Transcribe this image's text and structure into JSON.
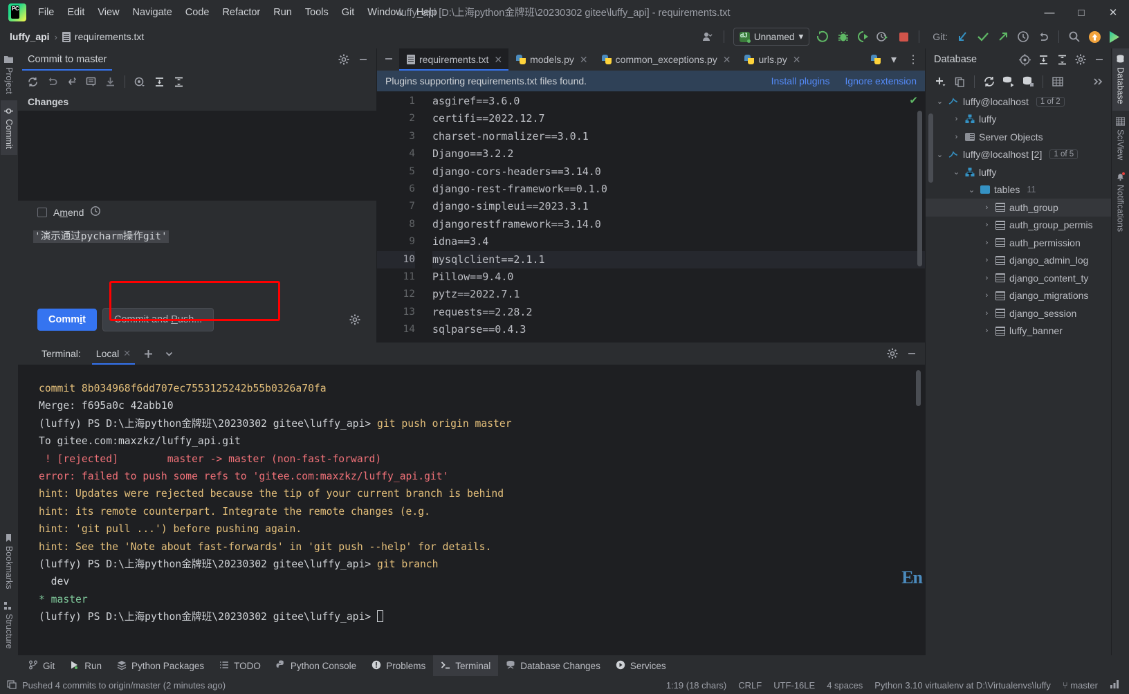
{
  "window": {
    "title": "luffy_api [D:\\上海python金牌班\\20230302 gitee\\luffy_api] - requirements.txt",
    "minimize": "—",
    "maximize": "□",
    "close": "✕"
  },
  "menu": {
    "items": [
      "File",
      "Edit",
      "View",
      "Navigate",
      "Code",
      "Refactor",
      "Run",
      "Tools",
      "Git",
      "Window",
      "Help"
    ]
  },
  "navbar": {
    "project": "luffy_api",
    "separator": "›",
    "file": "requirements.txt",
    "run_config": "Unnamed",
    "git_label": "Git:"
  },
  "left_stripe": {
    "items": [
      {
        "label": "Project",
        "icon": "folder-icon",
        "active": false
      },
      {
        "label": "Commit",
        "icon": "commit-icon",
        "active": true
      },
      {
        "label": "Bookmarks",
        "icon": "bookmark-icon",
        "active": false
      },
      {
        "label": "Structure",
        "icon": "structure-icon",
        "active": false
      }
    ]
  },
  "right_stripe": {
    "items": [
      {
        "label": "Database",
        "icon": "database-icon",
        "active": true
      },
      {
        "label": "SciView",
        "icon": "sciview-icon",
        "active": false
      },
      {
        "label": "Notifications",
        "icon": "bell-icon",
        "active": false
      }
    ]
  },
  "commit_panel": {
    "tab_label": "Commit to master",
    "changes_header": "Changes",
    "amend_label_pre": "A",
    "amend_label_underline": "m",
    "amend_label_post": "end",
    "message": "'演示通过pycharm操作git'",
    "commit_button": "Commit",
    "commit_button_underline": "i",
    "commit_push_button": "Commit and Push...",
    "toolbar_icons": [
      "refresh-icon",
      "rollback-icon",
      "revert-icon",
      "message-history-icon",
      "update-icon",
      "preview-diff-icon",
      "expand-all-icon",
      "collapse-all-icon"
    ],
    "header_icons": [
      "gear-icon",
      "minimize-icon"
    ]
  },
  "editor": {
    "tabs": [
      {
        "label": "requirements.txt",
        "icon": "text-file-icon",
        "active": true
      },
      {
        "label": "models.py",
        "icon": "python-file-icon",
        "active": false
      },
      {
        "label": "common_exceptions.py",
        "icon": "python-file-icon",
        "active": false
      },
      {
        "label": "urls.py",
        "icon": "python-file-icon",
        "active": false
      }
    ],
    "notification": {
      "text": "Plugins supporting requirements.txt files found.",
      "install_link": "Install plugins",
      "ignore_link": "Ignore extension"
    },
    "current_line": 10,
    "lines": [
      {
        "n": "1",
        "text": "asgiref==3.6.0"
      },
      {
        "n": "2",
        "text": "certifi==2022.12.7"
      },
      {
        "n": "3",
        "text": "charset-normalizer==3.0.1"
      },
      {
        "n": "4",
        "text": "Django==3.2.2"
      },
      {
        "n": "5",
        "text": "django-cors-headers==3.14.0"
      },
      {
        "n": "6",
        "text": "django-rest-framework==0.1.0"
      },
      {
        "n": "7",
        "text": "django-simpleui==2023.3.1"
      },
      {
        "n": "8",
        "text": "djangorestframework==3.14.0"
      },
      {
        "n": "9",
        "text": "idna==3.4"
      },
      {
        "n": "10",
        "text": "mysqlclient==2.1.1"
      },
      {
        "n": "11",
        "text": "Pillow==9.4.0"
      },
      {
        "n": "12",
        "text": "pytz==2022.7.1"
      },
      {
        "n": "13",
        "text": "requests==2.28.2"
      },
      {
        "n": "14",
        "text": "sqlparse==0.4.3"
      }
    ]
  },
  "database": {
    "title": "Database",
    "header_icons": [
      "target-icon",
      "expand-all-icon",
      "collapse-all-icon",
      "gear-icon",
      "minimize-icon"
    ],
    "toolbar_icons": [
      "add-icon",
      "copy-icon",
      "refresh-icon",
      "run-query-icon",
      "db-properties-icon",
      "table-editor-icon",
      "more-icon"
    ],
    "rows": [
      {
        "indent": 0,
        "arrow": "⌄",
        "icon": "connection-icon",
        "label": "luffy@localhost",
        "badge": "1 of 2"
      },
      {
        "indent": 1,
        "arrow": "›",
        "icon": "schema-icon",
        "label": "luffy",
        "badge": ""
      },
      {
        "indent": 1,
        "arrow": "›",
        "icon": "server-objects-icon",
        "label": "Server Objects",
        "badge": ""
      },
      {
        "indent": 0,
        "arrow": "⌄",
        "icon": "connection-icon",
        "label": "luffy@localhost [2]",
        "badge": "1 of 5"
      },
      {
        "indent": 1,
        "arrow": "⌄",
        "icon": "schema-icon",
        "label": "luffy",
        "badge": ""
      },
      {
        "indent": 2,
        "arrow": "⌄",
        "icon": "folder-icon",
        "label": "tables",
        "count": "11"
      },
      {
        "indent": 3,
        "arrow": "›",
        "icon": "table-icon",
        "label": "auth_group",
        "selected": true
      },
      {
        "indent": 3,
        "arrow": "›",
        "icon": "table-icon",
        "label": "auth_group_permis"
      },
      {
        "indent": 3,
        "arrow": "›",
        "icon": "table-icon",
        "label": "auth_permission"
      },
      {
        "indent": 3,
        "arrow": "›",
        "icon": "table-icon",
        "label": "django_admin_log"
      },
      {
        "indent": 3,
        "arrow": "›",
        "icon": "table-icon",
        "label": "django_content_ty"
      },
      {
        "indent": 3,
        "arrow": "›",
        "icon": "table-icon",
        "label": "django_migrations"
      },
      {
        "indent": 3,
        "arrow": "›",
        "icon": "table-icon",
        "label": "django_session"
      },
      {
        "indent": 3,
        "arrow": "›",
        "icon": "table-icon",
        "label": "luffy_banner"
      }
    ]
  },
  "terminal": {
    "label": "Terminal:",
    "tab": "Local",
    "add_icon": "+",
    "chevron_icon": "⌄",
    "lines": [
      {
        "color": "yellow",
        "text": "commit 8b034968f6dd707ec7553125242b55b0326a70fa"
      },
      {
        "color": "white",
        "text": "Merge: f695a0c 42abb10"
      },
      {
        "color": "prompt",
        "prompt": "(luffy) PS D:\\上海python金牌班\\20230302 gitee\\luffy_api> ",
        "cmd": "git push origin master"
      },
      {
        "color": "white",
        "text": "To gitee.com:maxzkz/luffy_api.git"
      },
      {
        "color": "red",
        "text": " ! [rejected]        master -> master (non-fast-forward)"
      },
      {
        "color": "red",
        "text": "error: failed to push some refs to 'gitee.com:maxzkz/luffy_api.git'"
      },
      {
        "color": "yellow",
        "text": "hint: Updates were rejected because the tip of your current branch is behind"
      },
      {
        "color": "yellow",
        "text": "hint: its remote counterpart. Integrate the remote changes (e.g."
      },
      {
        "color": "yellow",
        "text": "hint: 'git pull ...') before pushing again."
      },
      {
        "color": "yellow",
        "text": "hint: See the 'Note about fast-forwards' in 'git push --help' for details."
      },
      {
        "color": "prompt",
        "prompt": "(luffy) PS D:\\上海python金牌班\\20230302 gitee\\luffy_api> ",
        "cmd": "git branch"
      },
      {
        "color": "white",
        "text": "  dev"
      },
      {
        "color": "green",
        "text": "* master"
      },
      {
        "color": "cursor",
        "prompt": "(luffy) PS D:\\上海python金牌班\\20230302 gitee\\luffy_api> "
      }
    ],
    "watermark": "En"
  },
  "toolwindow_bar": {
    "items": [
      {
        "label": "Git",
        "icon": "git-branch-icon",
        "active": false
      },
      {
        "label": "Run",
        "icon": "run-icon",
        "active": false
      },
      {
        "label": "Python Packages",
        "icon": "packages-icon",
        "active": false
      },
      {
        "label": "TODO",
        "icon": "todo-icon",
        "active": false
      },
      {
        "label": "Python Console",
        "icon": "python-icon",
        "active": false
      },
      {
        "label": "Problems",
        "icon": "problems-icon",
        "active": false
      },
      {
        "label": "Terminal",
        "icon": "terminal-icon",
        "active": true
      },
      {
        "label": "Database Changes",
        "icon": "db-changes-icon",
        "active": false
      },
      {
        "label": "Services",
        "icon": "services-icon",
        "active": false
      }
    ]
  },
  "statusbar": {
    "message": "Pushed 4 commits to origin/master (2 minutes ago)",
    "caret": "1:19 (18 chars)",
    "line_sep": "CRLF",
    "encoding": "UTF-16LE",
    "indent": "4 spaces",
    "interpreter": "Python 3.10 virtualenv at D:\\Virtualenvs\\luffy",
    "branch": "master"
  },
  "colors": {
    "accent": "#3574f0",
    "highlight_box": "#ff0000",
    "error": "#f07178",
    "hint": "#e5c07b",
    "success": "#5fb865"
  }
}
